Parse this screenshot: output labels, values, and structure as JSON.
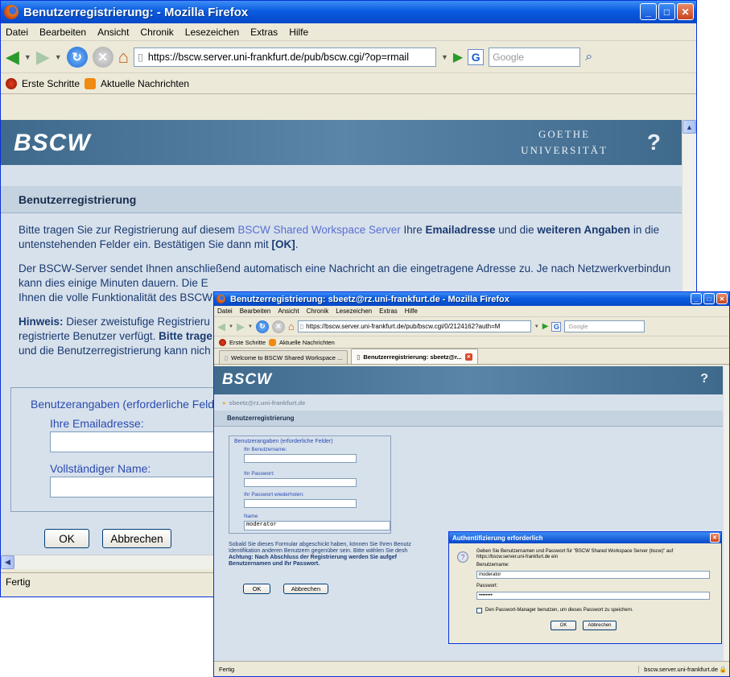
{
  "window1": {
    "title": "Benutzerregistrierung: - Mozilla Firefox",
    "menu": [
      "Datei",
      "Bearbeiten",
      "Ansicht",
      "Chronik",
      "Lesezeichen",
      "Extras",
      "Hilfe"
    ],
    "url": "https://bscw.server.uni-frankfurt.de/pub/bscw.cgi/?op=rmail",
    "search_placeholder": "Google",
    "bookmarks": [
      "Erste Schritte",
      "Aktuelle Nachrichten"
    ],
    "banner": {
      "logo": "BSCW",
      "goethe_line1": "GOETHE",
      "goethe_line2": "UNIVERSITÄT",
      "help": "?"
    },
    "section_title": "Benutzerregistrierung",
    "p1": {
      "a": "Bitte tragen Sie zur Registrierung auf diesem ",
      "link": "BSCW Shared Workspace Server",
      "b": " Ihre ",
      "bold1": "Emailadresse",
      "c": " und die ",
      "bold2": "weiteren Angaben",
      "d": " in die untenstehenden Felder ein. Bestätigen Sie dann mit ",
      "bold3": "[OK]",
      "e": "."
    },
    "p2_line1": "Der BSCW-Server sendet Ihnen anschließend automatisch eine Nachricht an die eingetragene Adresse zu. Je nach Netzwerkverbindun",
    "p2_line2": "kann dies einige Minuten dauern. Die E",
    "p2_line3": "Ihnen die volle Funktionalität des BSCW",
    "p3": {
      "hint": "Hinweis:",
      "l1": " Dieser zweistufige Registrieru",
      "l2a": "registrierte Benutzer verfügt. ",
      "l2b": "Bitte trage",
      "l3": "und die Benutzerregistrierung kann nich"
    },
    "fieldset_legend": "Benutzerangaben (erforderliche Felder",
    "email_label": "Ihre Emailadresse:",
    "name_label": "Vollständiger Name:",
    "ok": "OK",
    "cancel": "Abbrechen",
    "status": "Fertig"
  },
  "window2": {
    "title": "Benutzerregistrierung: sbeetz@rz.uni-frankfurt.de - Mozilla Firefox",
    "menu": [
      "Datei",
      "Bearbeiten",
      "Ansicht",
      "Chronik",
      "Lesezeichen",
      "Extras",
      "Hilfe"
    ],
    "url": "https://bscw.server.uni-frankfurt.de/pub/bscw.cgi/0/2124162?auth=M",
    "search_placeholder": "Google",
    "bookmarks": [
      "Erste Schritte",
      "Aktuelle Nachrichten"
    ],
    "tabs": [
      "Welcome to BSCW Shared Workspace ...",
      "Benutzerregistrierung: sbeetz@r..."
    ],
    "banner": {
      "logo": "BSCW",
      "help": "?"
    },
    "user": "sbeetz@rz.uni-frankfurt.de",
    "section_title": "Benutzerregistrierung",
    "legend": "Benutzerangaben (erforderliche Felder)",
    "label_user": "Ihr Benutzername:",
    "label_pw": "Ihr Passwort:",
    "label_pw2": "Ihr Passwort wiederholen:",
    "label_name": "Name",
    "name_value": "moderator",
    "para_l1": "Sobald Sie dieses Formular abgeschickt haben, können Sie Ihren Benutz",
    "para_l2": "Identifikation anderen Benutzern gegenüber sein. Bitte wählen Sie desh",
    "para_l3": "Achtung: Nach Abschluss der Registrierung werden Sie aufgef",
    "para_l4": "Benutzernamen und Ihr Passwort.",
    "ok": "OK",
    "cancel": "Abbrechen",
    "status": "Fertig",
    "status_right": "bscw.server.uni-frankfurt.de"
  },
  "dialog": {
    "title": "Authentifizierung erforderlich",
    "msg1": "Geben Sie Benutzernamen und Passwort für \"BSCW Shared Workspace Server (bscw)\" auf",
    "msg2": "https://bscw.server.uni-frankfurt.de ein",
    "user_label": "Benutzername:",
    "user_value": "moderator",
    "pw_label": "Passwort:",
    "pw_value": "••••••••",
    "remember": "Den Passwort-Manager benutzen, um dieses Passwort zu speichern.",
    "ok": "OK",
    "cancel": "Abbrechen"
  }
}
